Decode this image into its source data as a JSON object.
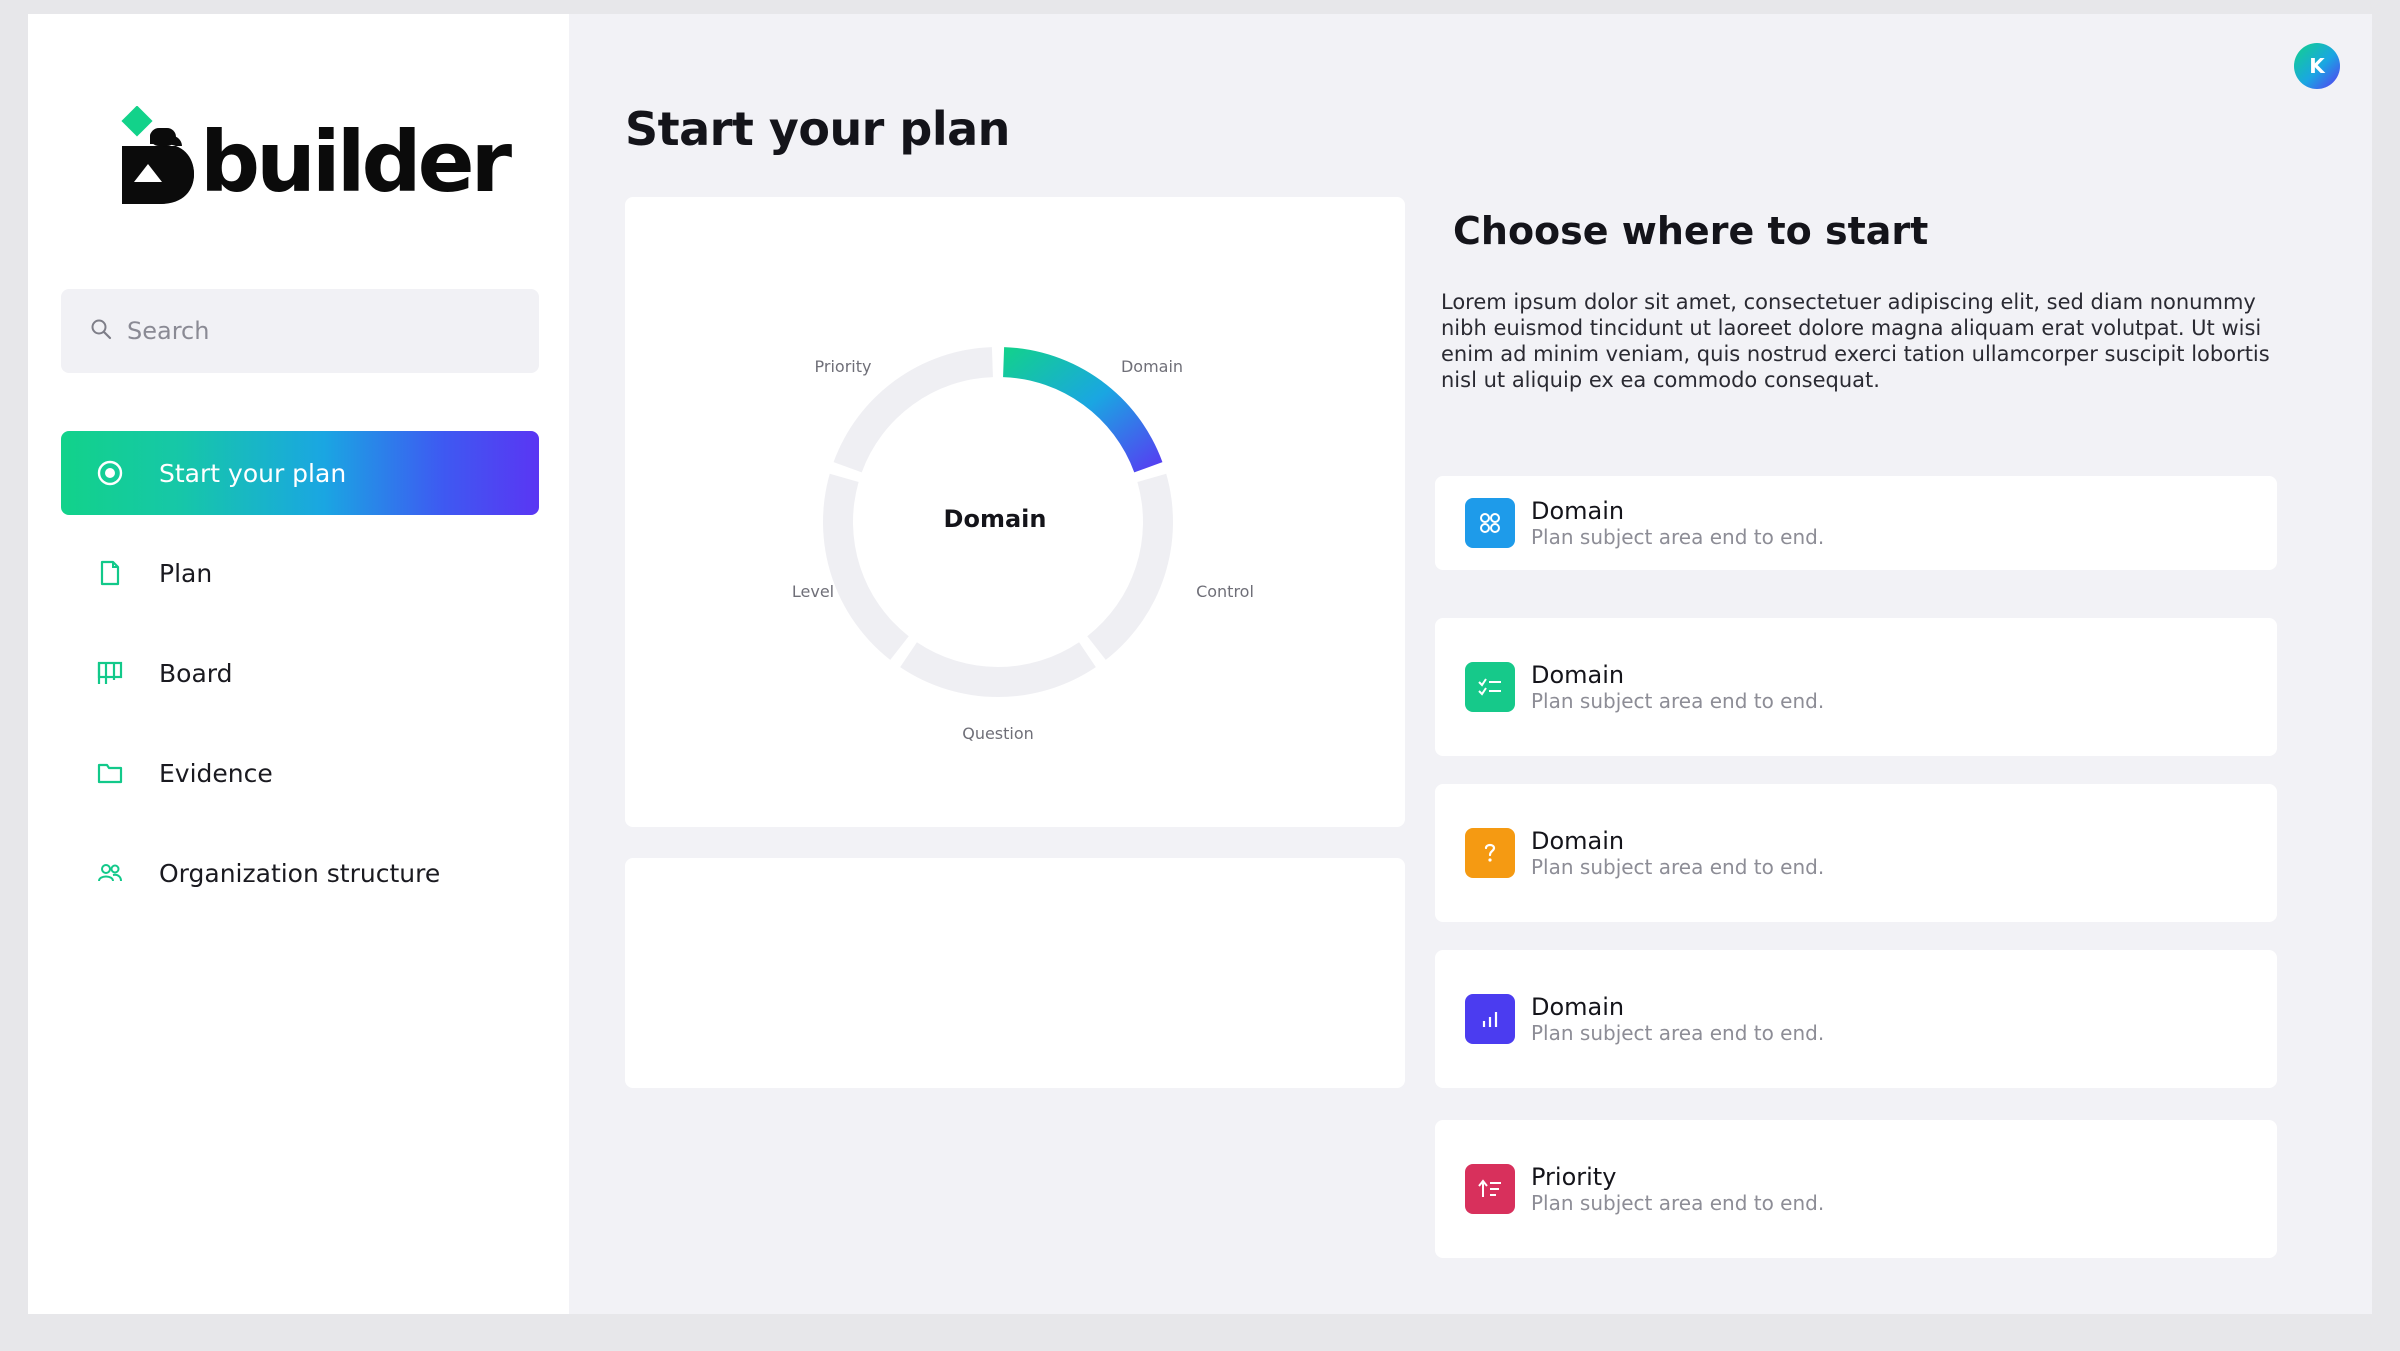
{
  "brand": {
    "name": "builder",
    "accent": "#12d28a",
    "accent_end": "#5a36f3"
  },
  "user": {
    "initial": "K"
  },
  "search": {
    "placeholder": "Search"
  },
  "sidebar": {
    "items": [
      {
        "label": "Start your plan",
        "icon": "target-icon",
        "active": true
      },
      {
        "label": "Plan",
        "icon": "document-icon",
        "active": false
      },
      {
        "label": "Board",
        "icon": "board-icon",
        "active": false
      },
      {
        "label": "Evidence",
        "icon": "folder-icon",
        "active": false
      },
      {
        "label": "Organization structure",
        "icon": "people-icon",
        "active": false
      }
    ]
  },
  "main": {
    "title": "Start your plan",
    "wheel": {
      "center_label": "Domain",
      "segments": [
        "Domain",
        "Control",
        "Question",
        "Level",
        "Priority"
      ],
      "active_segment": "Domain"
    },
    "choose": {
      "title": "Choose where to start",
      "description": "Lorem ipsum dolor sit amet, consectetuer adipiscing elit, sed diam nonummy nibh euismod tincidunt ut laoreet dolore magna aliquam erat volutpat. Ut wisi enim ad minim veniam, quis nostrud exerci tation ullamcorper suscipit lobortis nisl ut aliquip ex ea commodo consequat.",
      "options": [
        {
          "title": "Domain",
          "subtitle": "Plan subject area end to end.",
          "icon": "grid-icon",
          "color": "#1e9bea"
        },
        {
          "title": "Domain",
          "subtitle": "Plan subject area end to end.",
          "icon": "checklist-icon",
          "color": "#16c98a"
        },
        {
          "title": "Domain",
          "subtitle": "Plan subject area end to end.",
          "icon": "question-icon",
          "color": "#f59a12"
        },
        {
          "title": "Domain",
          "subtitle": "Plan subject area end to end.",
          "icon": "bar-chart-icon",
          "color": "#4b3cf0"
        },
        {
          "title": "Priority",
          "subtitle": "Plan subject area end to end.",
          "icon": "sort-icon",
          "color": "#d8305c"
        }
      ]
    }
  }
}
